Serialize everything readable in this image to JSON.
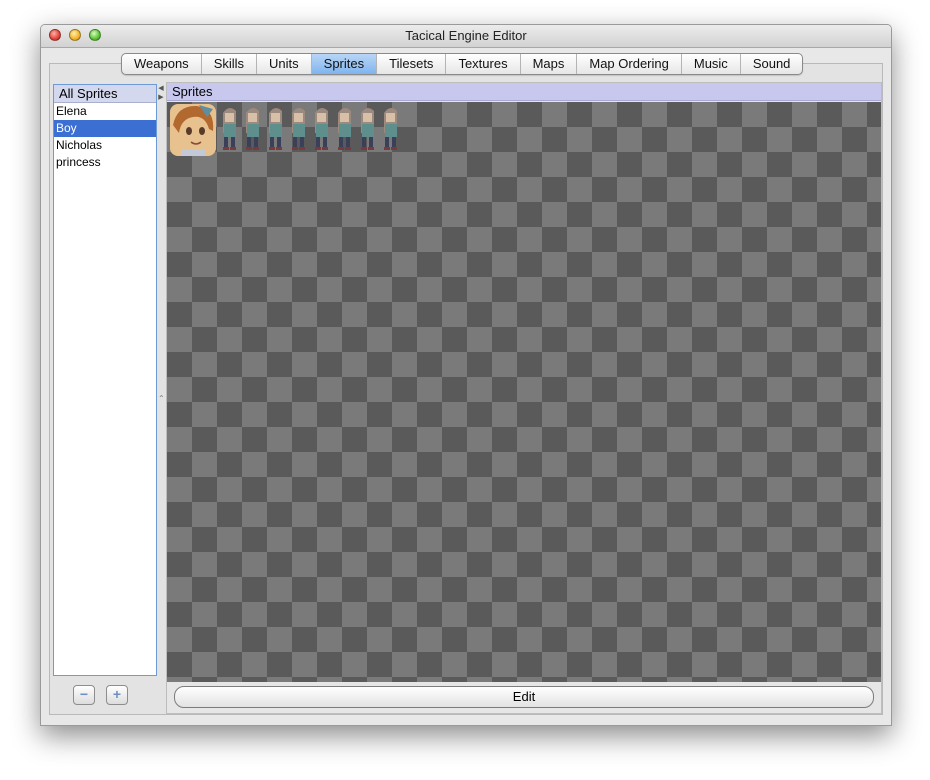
{
  "window": {
    "title": "Tacical Engine Editor"
  },
  "tabs": [
    "Weapons",
    "Skills",
    "Units",
    "Sprites",
    "Tilesets",
    "Textures",
    "Maps",
    "Map Ordering",
    "Music",
    "Sound"
  ],
  "selected_tab": "Sprites",
  "sprite_list": {
    "header": "All Sprites",
    "items": [
      "Elena",
      "Boy",
      "Nicholas",
      "princess"
    ],
    "selected": "Boy"
  },
  "buttons": {
    "remove_glyph": "−",
    "add_glyph": "+",
    "edit": "Edit"
  },
  "panel": {
    "header": "Sprites",
    "frame_count": 8
  },
  "colors": {
    "selection": "#3c6fd2",
    "tab_selected": "#7fb4ee",
    "panel_header": "#c8c8ef",
    "checker_dark": "#5a5a5a",
    "checker_light": "#7a7a7a"
  },
  "icons": {
    "close": "close-traffic-light-icon",
    "minimize": "minimize-traffic-light-icon",
    "zoom": "zoom-traffic-light-icon",
    "portrait": "character-portrait-icon",
    "frame": "sprite-frame-icon"
  }
}
